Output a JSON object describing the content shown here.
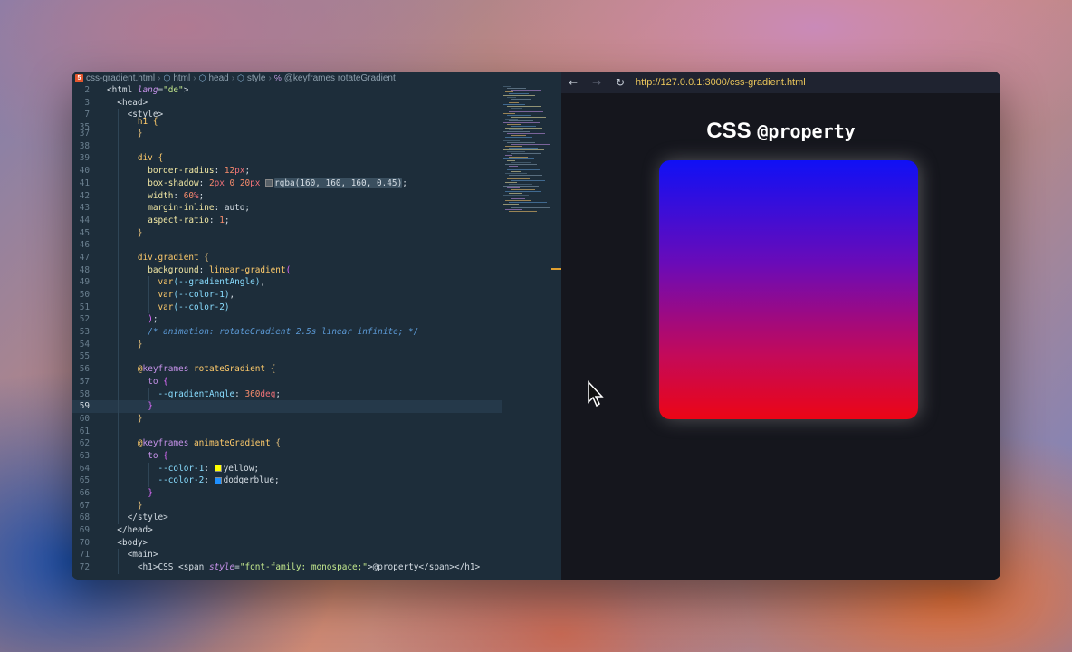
{
  "breadcrumb": {
    "file": "css-gradient.html",
    "items": [
      "html",
      "head",
      "style"
    ],
    "last": "@keyframes rotateGradient"
  },
  "browser": {
    "url": "http://127.0.0.1:3000/css-gradient.html",
    "back_icon": "←",
    "forward_icon": "→",
    "reload_icon": "↻",
    "heading_text": "CSS",
    "heading_mono": "@property"
  },
  "editor": {
    "lines": [
      {
        "n": "2",
        "indent": 0,
        "html": "<span class='t-tag'>&lt;html</span> <span class='t-attr'>lang</span>=<span class='t-str'>\"de\"</span><span class='t-tag'>&gt;</span>"
      },
      {
        "n": "3",
        "indent": 1,
        "html": "<span class='t-tag'>&lt;head&gt;</span>"
      },
      {
        "n": "7",
        "indent": 2,
        "html": "<span class='t-tag'>&lt;style&gt;</span>"
      },
      {
        "n": "35",
        "indent": 3,
        "html": "<span class='t-sel'>h1 {</span>",
        "sticky": true
      },
      {
        "n": "37",
        "indent": 3,
        "html": "<span class='t-brk'>}</span>"
      },
      {
        "n": "38",
        "indent": 3,
        "html": ""
      },
      {
        "n": "39",
        "indent": 3,
        "html": "<span class='t-sel'>div {</span>"
      },
      {
        "n": "40",
        "indent": 4,
        "html": "<span class='t-prop'>border-radius</span>: <span class='t-num'>12</span><span class='t-unit'>px</span>;"
      },
      {
        "n": "41",
        "indent": 4,
        "html": "<span class='t-prop'>box-shadow</span>: <span class='t-num'>2</span><span class='t-unit'>px</span> <span class='t-num'>0</span> <span class='t-num'>20</span><span class='t-unit'>px</span> <span class='swatch' style='background:rgba(160,160,160,0.45)'></span><span class='hl'>rgba(160, 160, 160, 0.45)</span>;"
      },
      {
        "n": "42",
        "indent": 4,
        "html": "<span class='t-prop'>width</span>: <span class='t-num'>60</span><span class='t-unit'>%</span>;"
      },
      {
        "n": "43",
        "indent": 4,
        "html": "<span class='t-prop'>margin-inline</span>: auto;"
      },
      {
        "n": "44",
        "indent": 4,
        "html": "<span class='t-prop'>aspect-ratio</span>: <span class='t-num'>1</span>;"
      },
      {
        "n": "45",
        "indent": 3,
        "html": "<span class='t-brk'>}</span>"
      },
      {
        "n": "46",
        "indent": 3,
        "html": ""
      },
      {
        "n": "47",
        "indent": 3,
        "html": "<span class='t-sel'>div.</span><span class='t-fn'>gradient</span> <span class='t-brk'>{</span>"
      },
      {
        "n": "48",
        "indent": 4,
        "html": "<span class='t-prop'>background</span>: <span class='t-fn'>linear-gradient</span><span class='t-purple'>(</span>"
      },
      {
        "n": "49",
        "indent": 5,
        "html": "<span class='t-fn'>var</span><span class='t-var'>(--gradientAngle)</span>,"
      },
      {
        "n": "50",
        "indent": 5,
        "html": "<span class='t-fn'>var</span><span class='t-var'>(--color-1)</span>,"
      },
      {
        "n": "51",
        "indent": 5,
        "html": "<span class='t-fn'>var</span><span class='t-var'>(--color-2)</span>"
      },
      {
        "n": "52",
        "indent": 4,
        "html": "<span class='t-purple'>)</span>;"
      },
      {
        "n": "53",
        "indent": 4,
        "html": "<span class='t-cm'>/* animation: rotateGradient 2.5s linear infinite; */</span>"
      },
      {
        "n": "54",
        "indent": 3,
        "html": "<span class='t-brk'>}</span>"
      },
      {
        "n": "55",
        "indent": 3,
        "html": ""
      },
      {
        "n": "56",
        "indent": 3,
        "html": "<span class='t-at'>@</span><span class='t-kw'>keyframes</span> <span class='t-fn'>rotateGradient</span> <span class='t-brk'>{</span>"
      },
      {
        "n": "57",
        "indent": 4,
        "html": "<span class='t-kw'>to</span> <span class='t-purple'>{</span>"
      },
      {
        "n": "58",
        "indent": 5,
        "html": "<span class='t-var'>--gradientAngle</span>: <span class='t-num'>360</span><span class='t-unit'>deg</span>;"
      },
      {
        "n": "59",
        "indent": 4,
        "html": "<span class='t-purple'>}</span>",
        "active": true
      },
      {
        "n": "60",
        "indent": 3,
        "html": "<span class='t-brk'>}</span>"
      },
      {
        "n": "61",
        "indent": 3,
        "html": ""
      },
      {
        "n": "62",
        "indent": 3,
        "html": "<span class='t-at'>@</span><span class='t-kw'>keyframes</span> <span class='t-fn'>animateGradient</span> <span class='t-brk'>{</span>"
      },
      {
        "n": "63",
        "indent": 4,
        "html": "<span class='t-kw'>to</span> <span class='t-purple'>{</span>"
      },
      {
        "n": "64",
        "indent": 5,
        "html": "<span class='t-var'>--color-1</span>: <span class='swatch' style='background:yellow'></span>yellow;"
      },
      {
        "n": "65",
        "indent": 5,
        "html": "<span class='t-var'>--color-2</span>: <span class='swatch' style='background:dodgerblue'></span>dodgerblue;"
      },
      {
        "n": "66",
        "indent": 4,
        "html": "<span class='t-purple'>}</span>"
      },
      {
        "n": "67",
        "indent": 3,
        "html": "<span class='t-brk'>}</span>"
      },
      {
        "n": "68",
        "indent": 2,
        "html": "<span class='t-tag'>&lt;/style&gt;</span>"
      },
      {
        "n": "69",
        "indent": 1,
        "html": "<span class='t-tag'>&lt;/head&gt;</span>"
      },
      {
        "n": "70",
        "indent": 1,
        "html": "<span class='t-tag'>&lt;body&gt;</span>"
      },
      {
        "n": "71",
        "indent": 2,
        "html": "<span class='t-tag'>&lt;main&gt;</span>"
      },
      {
        "n": "72",
        "indent": 3,
        "html": "<span class='t-tag'>&lt;h1&gt;</span>CSS <span class='t-tag'>&lt;span</span> <span class='t-attr'>style</span>=<span class='t-str'>\"font-family: monospace;\"</span><span class='t-tag'>&gt;</span>@property<span class='t-tag'>&lt;/span&gt;&lt;/h1&gt;</span>"
      }
    ]
  },
  "colors": {
    "gradient_top": "#1010f5",
    "gradient_bottom": "#ec0515"
  }
}
